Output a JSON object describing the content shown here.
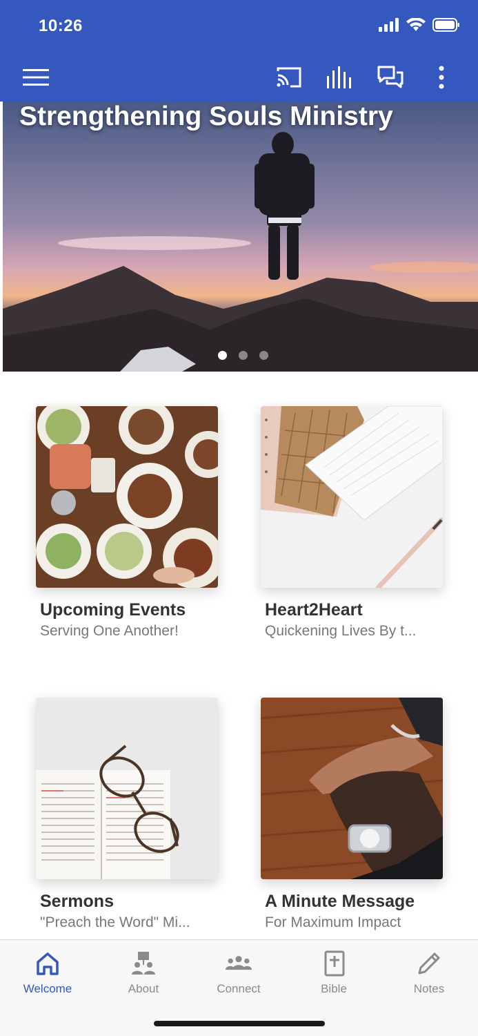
{
  "status_bar": {
    "time": "10:26"
  },
  "colors": {
    "primary": "#3458be",
    "text_dark": "#333333",
    "text_muted": "#777777",
    "nav_inactive": "#8a8a8a"
  },
  "toolbar": {
    "icons": [
      "menu-icon",
      "cast-icon",
      "audio-bars-icon",
      "chat-icon",
      "more-vertical-icon"
    ]
  },
  "hero": {
    "title": "Strengthening Souls Ministry",
    "slides_count": 3,
    "active_slide": 1
  },
  "cards": [
    {
      "title": "Upcoming Events",
      "subtitle": "Serving One Another!",
      "image": "food-table-photo"
    },
    {
      "title": "Heart2Heart",
      "subtitle": "Quickening Lives By t...",
      "image": "notebook-pen-photo"
    },
    {
      "title": "Sermons",
      "subtitle": "\"Preach the Word\" Mi...",
      "image": "bible-glasses-photo"
    },
    {
      "title": "A Minute Message",
      "subtitle": "For Maximum Impact",
      "image": "hands-watch-photo"
    }
  ],
  "bottom_nav": {
    "items": [
      {
        "label": "Welcome",
        "icon": "home-icon",
        "active": true
      },
      {
        "label": "About",
        "icon": "people-icon",
        "active": false
      },
      {
        "label": "Connect",
        "icon": "group-icon",
        "active": false
      },
      {
        "label": "Bible",
        "icon": "bible-icon",
        "active": false
      },
      {
        "label": "Notes",
        "icon": "pencil-icon",
        "active": false
      }
    ]
  }
}
